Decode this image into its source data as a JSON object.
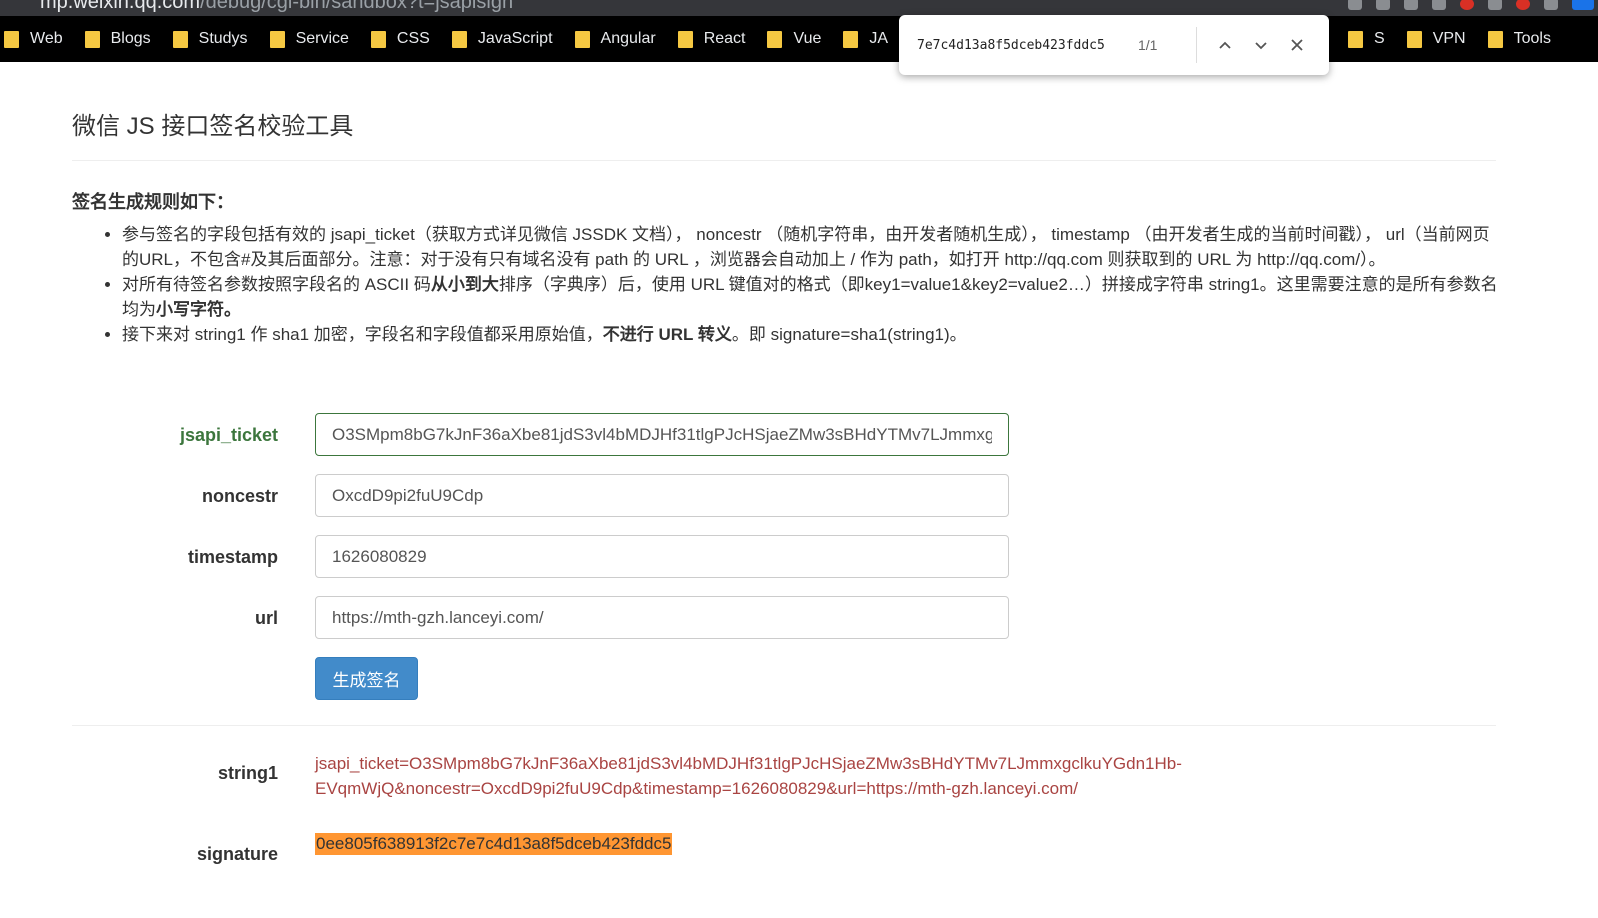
{
  "browser": {
    "url_host": "mp.weixin.qq.com",
    "url_path": "/debug/cgi-bin/sandbox?t=jsapisign",
    "bookmarks": [
      {
        "label": "Web"
      },
      {
        "label": "Blogs"
      },
      {
        "label": "Studys"
      },
      {
        "label": "Service"
      },
      {
        "label": "CSS"
      },
      {
        "label": "JavaScript"
      },
      {
        "label": "Angular"
      },
      {
        "label": "React"
      },
      {
        "label": "Vue"
      },
      {
        "label": "JA"
      },
      {
        "label": "S"
      },
      {
        "label": "VPN"
      },
      {
        "label": "Tools"
      }
    ]
  },
  "find_bar": {
    "query": "7e7c4d13a8f5dceb423fddc5",
    "count": "1/1"
  },
  "page": {
    "title": "微信 JS 接口签名校验工具",
    "rules_heading": "签名生成规则如下：",
    "rule1": "参与签名的字段包括有效的 jsapi_ticket（获取方式详见微信 JSSDK 文档）， noncestr （随机字符串，由开发者随机生成）， timestamp （由开发者生成的当前时间戳）， url（当前网页的URL，不包含#及其后面部分。注意：对于没有只有域名没有 path 的 URL ，浏览器会自动加上 / 作为 path，如打开 http://qq.com 则获取到的 URL 为 http://qq.com/）。",
    "rule2_a": "对所有待签名参数按照字段名的 ASCII 码",
    "rule2_b": "从小到大",
    "rule2_c": "排序（字典序）后，使用 URL 键值对的格式（即key1=value1&key2=value2…）拼接成字符串 string1。这里需要注意的是所有参数名均为",
    "rule2_d": "小写字符。",
    "rule3_a": "接下来对 string1 作 sha1 加密，字段名和字段值都采用原始值，",
    "rule3_b": "不进行 URL 转义",
    "rule3_c": "。即 signature=sha1(string1)。"
  },
  "form": {
    "jsapi_ticket": {
      "label": "jsapi_ticket",
      "value": "O3SMpm8bG7kJnF36aXbe81jdS3vl4bMDJHf31tlgPJcHSjaeZMw3sBHdYTMv7LJmmxgclkuYGdn1Hb-EVqmWjQ"
    },
    "noncestr": {
      "label": "noncestr",
      "value": "OxcdD9pi2fuU9Cdp"
    },
    "timestamp": {
      "label": "timestamp",
      "value": "1626080829"
    },
    "url": {
      "label": "url",
      "value": "https://mth-gzh.lanceyi.com/"
    },
    "submit_label": "生成签名"
  },
  "result": {
    "string1_label": "string1",
    "string1_line1": "jsapi_ticket=O3SMpm8bG7kJnF36aXbe81jdS3vl4bMDJHf31tlgPJcHSjaeZMw3sBHdYTMv7LJmmxgclkuYGdn1Hb-",
    "string1_line2": "EVqmWjQ&noncestr=OxcdD9pi2fuU9Cdp&timestamp=1626080829&url=https://mth-gzh.lanceyi.com/",
    "signature_label": "signature",
    "signature_value": "0ee805f638913f2c7e7c4d13a8f5dceb423fddc5"
  },
  "colors": {
    "valid_green": "#3c763d",
    "error_red": "#a94442",
    "primary_blue": "#428bca",
    "find_highlight": "#ff9632"
  }
}
